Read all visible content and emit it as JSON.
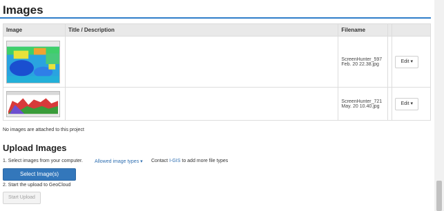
{
  "page": {
    "heading": "Images"
  },
  "table": {
    "headers": {
      "image": "Image",
      "title": "Title / Description",
      "filename": "Filename"
    },
    "rows": [
      {
        "title": "",
        "filename_line1": "ScreenHunter_597",
        "filename_line2": "Feb. 20 22.38.jpg",
        "edit_label": "Edit ▾"
      },
      {
        "title": "",
        "filename_line1": "ScreenHunter_721",
        "filename_line2": "May. 20 10.40.jpg",
        "edit_label": "Edit ▾"
      }
    ]
  },
  "note": "No images are attached to this project",
  "upload": {
    "heading": "Upload Images",
    "step1": "1. Select images from your computer.",
    "allowed_link": "Allowed image types ▾",
    "contact_prefix": "Contact",
    "contact_link": "I-GIS",
    "contact_suffix": "to add more file types",
    "select_button": "Select Image(s)",
    "step2": "2. Start the upload to GeoCloud",
    "start_button": "Start Upload"
  },
  "colors": {
    "accent": "#2f7dc9",
    "primary_button": "#3377bb",
    "link": "#2f6fb1"
  }
}
